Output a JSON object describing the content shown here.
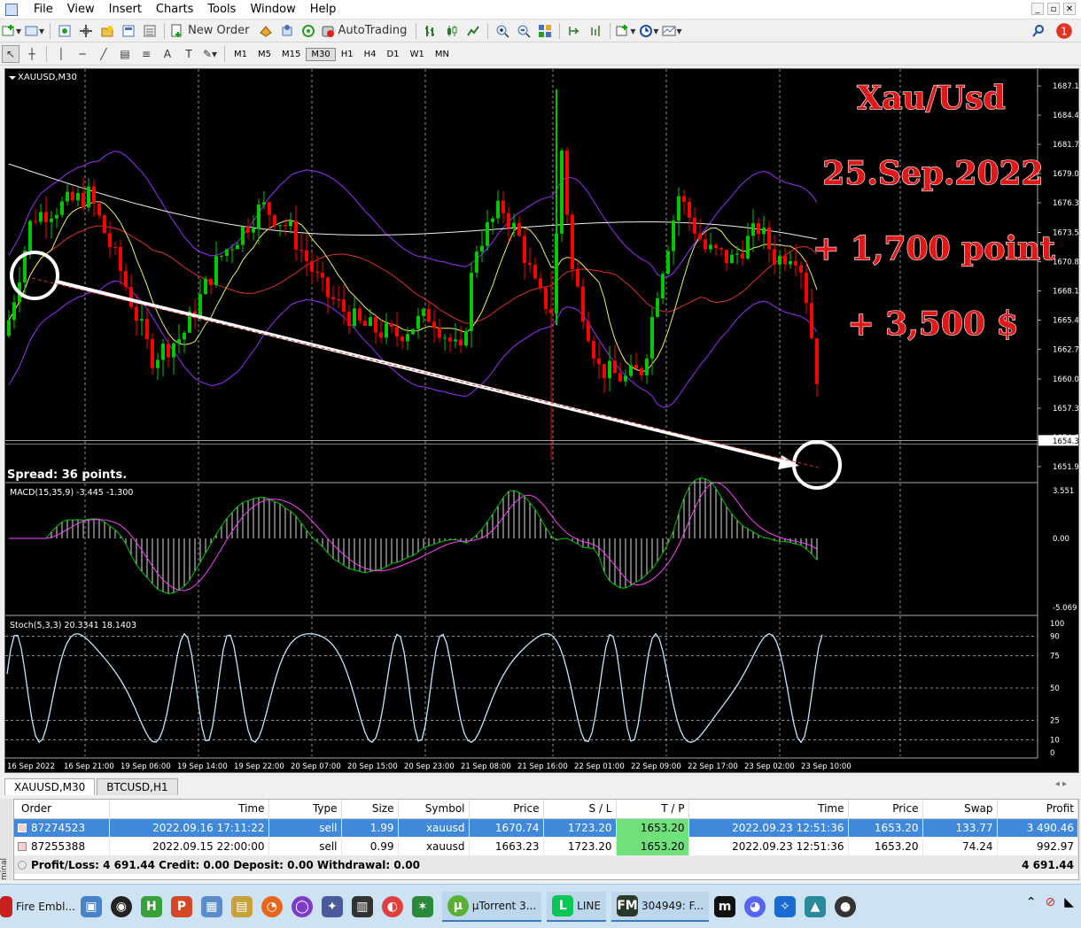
{
  "menu": [
    "File",
    "View",
    "Insert",
    "Charts",
    "Tools",
    "Window",
    "Help"
  ],
  "toolbar": {
    "new_order": "New Order",
    "autotrading": "AutoTrading",
    "timeframes": [
      "M1",
      "M5",
      "M15",
      "M30",
      "H1",
      "H4",
      "D1",
      "W1",
      "MN"
    ],
    "active_timeframe": "M30",
    "notification_count": "1"
  },
  "chart": {
    "symbol_label": "XAUUSD,M30",
    "spread": "Spread: 36 points.",
    "overlay_lines": [
      "Xau/Usd",
      "25.Sep.2022",
      "+ 1,700 point",
      "+ 3,500 $"
    ],
    "price_ticks": [
      "1687.10",
      "1684.40",
      "1681.70",
      "1679.00",
      "1676.30",
      "1673.55",
      "1670.85",
      "1668.15",
      "1665.45",
      "1662.75",
      "1660.00",
      "1657.30",
      "1654.60",
      "1651.90"
    ],
    "current_price": "1654.32",
    "time_ticks": [
      "16 Sep 2022",
      "16 Sep 21:00",
      "19 Sep 06:00",
      "19 Sep 14:00",
      "19 Sep 22:00",
      "20 Sep 07:00",
      "20 Sep 15:00",
      "20 Sep 23:00",
      "21 Sep 08:00",
      "21 Sep 16:00",
      "22 Sep 01:00",
      "22 Sep 09:00",
      "22 Sep 17:00",
      "23 Sep 02:00",
      "23 Sep 10:00"
    ],
    "macd_label": "MACD(15,35,9) -3.445 -1.300",
    "macd_ticks": [
      "3.551",
      "0.00",
      "-5.069"
    ],
    "stoch_label": "Stoch(5,3,3) 20.3341 18.1403",
    "stoch_ticks": [
      "100",
      "90",
      "75",
      "50",
      "25",
      "10",
      "0"
    ],
    "colors": {
      "bull": "#00c800",
      "bear": "#ff0000",
      "ma_white": "#f0f0f0",
      "ma_red": "#e03030",
      "ma_yellow": "#f0f060",
      "bands": "#9b30ff",
      "macd_signal": "#ff40ff",
      "stoch": "#bfe9ff",
      "overlay_text": "#e01818"
    }
  },
  "tabs": [
    "XAUUSD,M30",
    "BTCUSD,H1"
  ],
  "orders": {
    "columns": [
      "Order",
      "Time",
      "Type",
      "Size",
      "Symbol",
      "Price",
      "S / L",
      "T / P",
      "Time",
      "Price",
      "Swap",
      "Profit"
    ],
    "rows": [
      [
        "87274523",
        "2022.09.16 17:11:22",
        "sell",
        "1.99",
        "xauusd",
        "1670.74",
        "1723.20",
        "1653.20",
        "2022.09.23 12:51:36",
        "1653.20",
        "133.77",
        "3 490.46"
      ],
      [
        "87255388",
        "2022.09.15 22:00:00",
        "sell",
        "0.99",
        "xauusd",
        "1663.23",
        "1723.20",
        "1653.20",
        "2022.09.23 12:51:36",
        "1653.20",
        "74.24",
        "992.97"
      ]
    ],
    "summary": "Profit/Loss: 4 691.44  Credit: 0.00  Deposit: 0.00  Withdrawal: 0.00",
    "total": "4 691.44"
  },
  "sidebar_label": "minal",
  "taskbar": {
    "items": [
      "Fire Embl...",
      "µTorrent 3...",
      "LINE",
      "304949: F..."
    ]
  }
}
